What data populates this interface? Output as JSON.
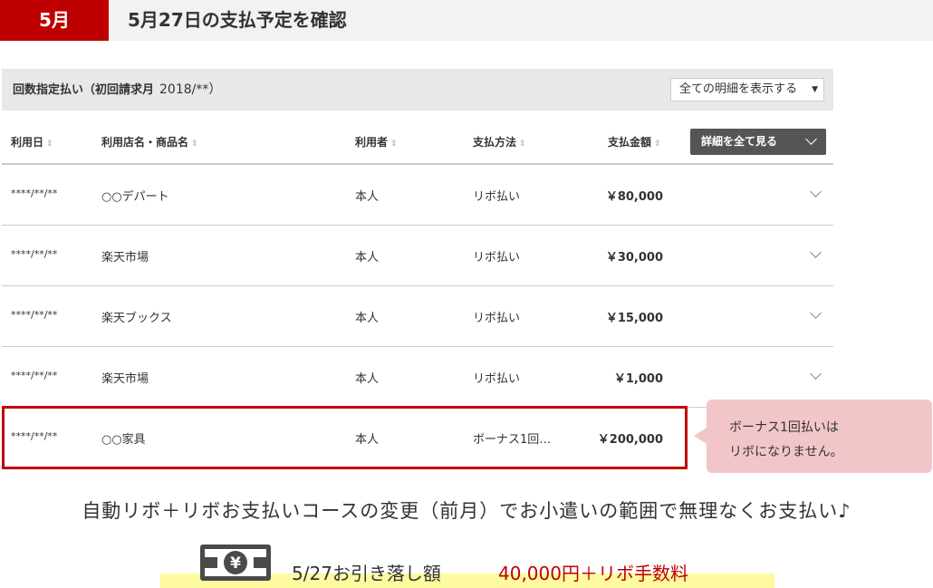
{
  "header": {
    "month": "5月",
    "title": "5月27日の支払予定を確認"
  },
  "section": {
    "title": "回数指定払い（初回請求月",
    "date": "2018/**）"
  },
  "filter": {
    "selected": "全ての明細を表示する",
    "arrow": "▼"
  },
  "columns": {
    "date": "利用日",
    "store": "利用店名・商品名",
    "user": "利用者",
    "method": "支払方法",
    "amount": "支払金額",
    "sort_icon": "⇕"
  },
  "detail_button": "詳細を全て見る",
  "rows": [
    {
      "date": "****/**/**",
      "store": "○○デパート",
      "user": "本人",
      "method": "リボ払い",
      "amount": "￥80,000"
    },
    {
      "date": "****/**/**",
      "store": "楽天市場",
      "user": "本人",
      "method": "リボ払い",
      "amount": "￥30,000"
    },
    {
      "date": "****/**/**",
      "store": "楽天ブックス",
      "user": "本人",
      "method": "リボ払い",
      "amount": "￥15,000"
    },
    {
      "date": "****/**/**",
      "store": "楽天市場",
      "user": "本人",
      "method": "リボ払い",
      "amount": "￥1,000"
    },
    {
      "date": "****/**/**",
      "store": "○○家具",
      "user": "本人",
      "method": "ボーナス1回…",
      "amount": "￥200,000"
    }
  ],
  "callout": {
    "line1": "ボーナス1回払いは",
    "line2": "リボになりません。"
  },
  "note": "自動リボ＋リボお支払いコースの変更（前月）でお小遣いの範囲で無理なくお支払い♪",
  "debit": {
    "label": "5/27お引き落し額",
    "amount": "40,000円＋リボ手数料"
  },
  "icons": {
    "bill": "yen-bill-icon",
    "sort": "sort-arrows-icon",
    "row_expand": "chevron-down-icon"
  },
  "colors": {
    "accent": "#bf0000",
    "callout_bg": "#f2c6c8",
    "highlight": "#fdfaa0"
  }
}
